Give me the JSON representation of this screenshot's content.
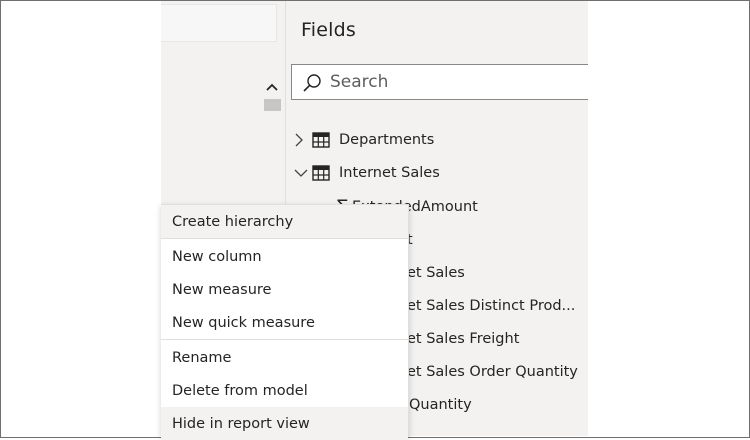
{
  "fields_pane": {
    "title": "Fields",
    "search_placeholder": "Search",
    "tables": [
      {
        "label": "Departments",
        "expanded": false
      },
      {
        "label": "Internet Sales",
        "expanded": true
      }
    ],
    "partial_items": [
      "ExtendedAmount",
      "t",
      "et Sales",
      "et Sales Distinct Prod...",
      "et Sales Freight",
      "et Sales Order Quantity",
      "Quantity"
    ]
  },
  "context_menu": {
    "items": [
      {
        "label": "Create hierarchy"
      },
      {
        "label": "New column"
      },
      {
        "label": "New measure"
      },
      {
        "label": "New quick measure"
      },
      {
        "label": "Rename"
      },
      {
        "label": "Delete from model"
      },
      {
        "label": "Hide in report view"
      }
    ]
  },
  "colors": {
    "pane_bg": "#f3f2f1",
    "text": "#252423",
    "menu_bg": "#ffffff",
    "border": "#8a8886"
  }
}
